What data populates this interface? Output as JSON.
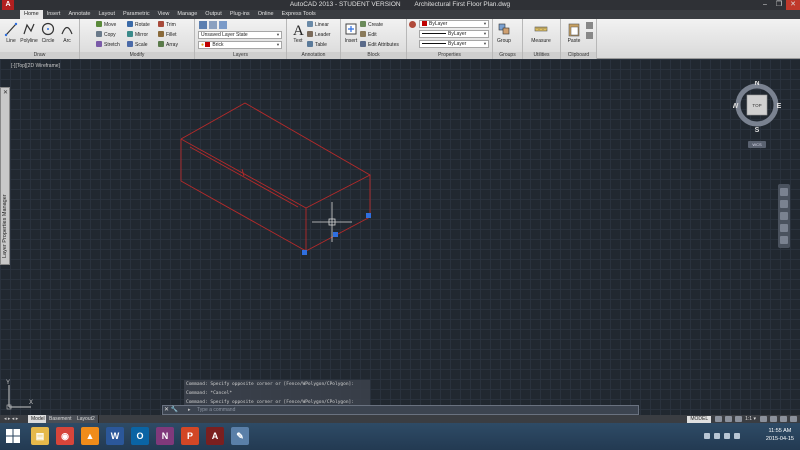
{
  "app": {
    "logo": "A",
    "title": "AutoCAD 2013 - STUDENT VERSION",
    "document": "Architectural First Floor Plan.dwg",
    "window_controls": [
      "–",
      "❐",
      "✕"
    ]
  },
  "ribbon_tabs": [
    "Home",
    "Insert",
    "Annotate",
    "Layout",
    "Parametric",
    "View",
    "Manage",
    "Output",
    "Plug-ins",
    "Online",
    "Express Tools"
  ],
  "ribbon": {
    "draw": {
      "title": "Draw",
      "line": "Line",
      "polyline": "Polyline",
      "circle": "Circle",
      "arc": "Arc"
    },
    "modify": {
      "title": "Modify",
      "move": "Move",
      "rotate": "Rotate",
      "trim": "Trim",
      "copy": "Copy",
      "mirror": "Mirror",
      "fillet": "Fillet",
      "stretch": "Stretch",
      "scale": "Scale",
      "array": "Array"
    },
    "layers": {
      "title": "Layers",
      "layer_state": "Unsaved Layer State",
      "current_layer": "Brick"
    },
    "annotation": {
      "title": "Annotation",
      "text": "Text",
      "linear": "Linear",
      "leader": "Leader",
      "table": "Table"
    },
    "block": {
      "title": "Block",
      "insert": "Insert",
      "create": "Create",
      "edit": "Edit",
      "edit_attributes": "Edit Attributes"
    },
    "properties": {
      "title": "Properties",
      "color": "ByLayer",
      "linetype": "ByLayer",
      "lineweight": "ByLayer"
    },
    "groups": {
      "title": "Groups",
      "group": "Group"
    },
    "utilities": {
      "title": "Utilities",
      "measure": "Measure"
    },
    "clipboard": {
      "title": "Clipboard",
      "paste": "Paste"
    }
  },
  "viewport": {
    "label": "[-][Top][2D Wireframe]"
  },
  "palette": {
    "title": "Layer Properties Manager",
    "close": "✕"
  },
  "viewcube": {
    "face": "TOP",
    "north": "N",
    "south": "S",
    "east": "E",
    "west": "W",
    "wcs": "WCS"
  },
  "ucs": {
    "x": "X",
    "y": "Y"
  },
  "command": {
    "history": [
      "Command: Specify opposite corner or [Fence/WPolygon/CPolygon]:",
      "Command: *Cancel*",
      "Command: Specify opposite corner or [Fence/WPolygon/CPolygon]:"
    ],
    "buttons": "✕ 🔧",
    "prompt": "▸",
    "placeholder": "Type a command"
  },
  "layout_tabs": {
    "nav": "◂ ▸ ◂ ▸",
    "tabs": [
      "Model",
      "Basement",
      "Layout2"
    ],
    "active": "Model"
  },
  "status": {
    "model": "MODEL",
    "scale": "1:1 ▾"
  },
  "taskbar": {
    "apps": [
      {
        "name": "file-explorer-icon",
        "glyph": "▤",
        "color": "#e6b84a"
      },
      {
        "name": "chrome-icon",
        "glyph": "◉",
        "color": "#d6453a"
      },
      {
        "name": "vlc-icon",
        "glyph": "▲",
        "color": "#f08c1a"
      },
      {
        "name": "word-icon",
        "glyph": "W",
        "color": "#2b579a"
      },
      {
        "name": "outlook-icon",
        "glyph": "O",
        "color": "#0a64a4"
      },
      {
        "name": "onenote-icon",
        "glyph": "N",
        "color": "#80397b"
      },
      {
        "name": "powerpoint-icon",
        "glyph": "P",
        "color": "#d24726"
      },
      {
        "name": "autocad-icon",
        "glyph": "A",
        "color": "#7a1f1f"
      },
      {
        "name": "paint-icon",
        "glyph": "✎",
        "color": "#5a7fa8"
      }
    ],
    "time": "11:55 AM",
    "date": "2015-04-15"
  },
  "colors": {
    "accent": "#c00000",
    "drawing_line": "#b52a2a",
    "grip": "#2f6fe0",
    "canvas": "#212830"
  }
}
